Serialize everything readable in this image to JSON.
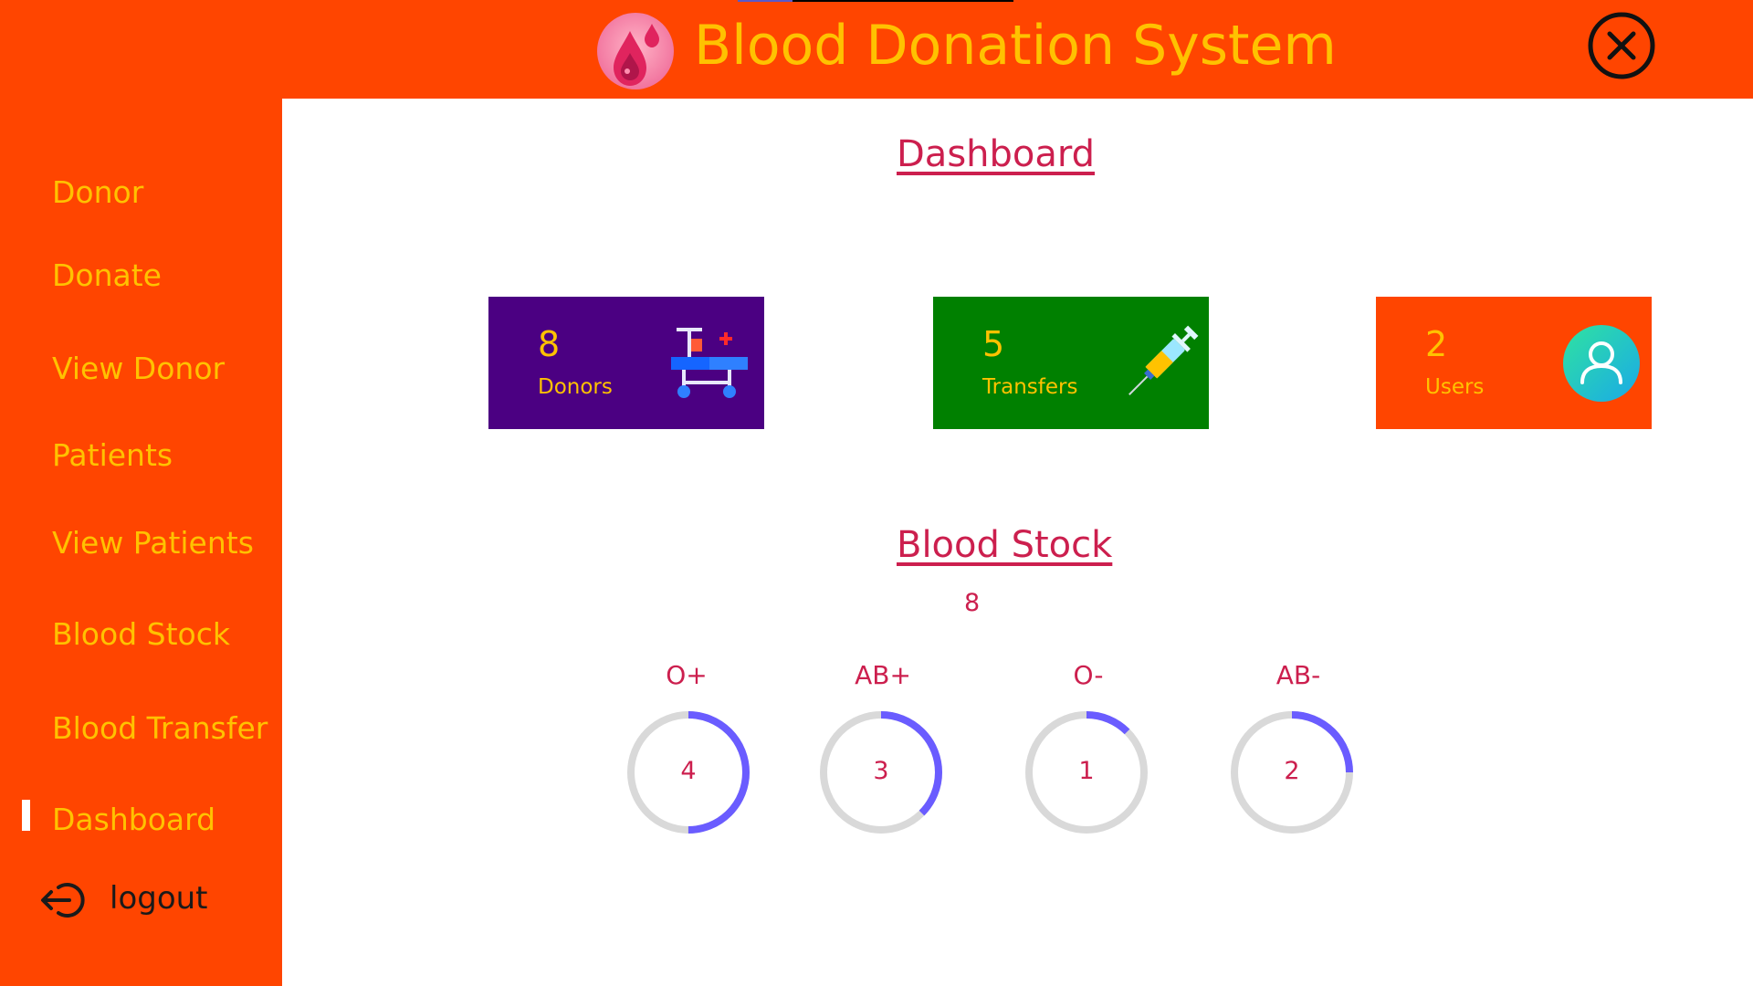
{
  "app": {
    "title": "Blood Donation System",
    "brand_color": "#ff4500",
    "accent_text_color": "#ffc200",
    "heading_color": "#cc1f4e",
    "logo_icon": "blood-drops-icon",
    "close_icon": "close-circle-icon"
  },
  "sidebar": {
    "items": [
      {
        "label": "Donor"
      },
      {
        "label": "Donate"
      },
      {
        "label": "View Donor"
      },
      {
        "label": "Patients"
      },
      {
        "label": "View Patients"
      },
      {
        "label": "Blood Stock"
      },
      {
        "label": "Blood Transfer"
      },
      {
        "label": "Dashboard",
        "active": true
      }
    ],
    "logout": {
      "label": "logout",
      "icon": "logout-icon"
    }
  },
  "dashboard": {
    "title": "Dashboard",
    "cards": [
      {
        "count": "8",
        "label": "Donors",
        "color": "#4b0082",
        "icon": "hospital-bed-icon"
      },
      {
        "count": "5",
        "label": "Transfers",
        "color": "#008000",
        "icon": "syringe-icon"
      },
      {
        "count": "2",
        "label": "Users",
        "color": "#ff4500",
        "icon": "user-avatar-icon"
      }
    ]
  },
  "blood_stock": {
    "title": "Blood Stock",
    "total": "8",
    "gauge_track_color": "#d9d9d9",
    "gauge_fill_color": "#6a5cff",
    "groups": [
      {
        "type": "O+",
        "value": "4",
        "fill_fraction": 0.5
      },
      {
        "type": "AB+",
        "value": "3",
        "fill_fraction": 0.375
      },
      {
        "type": "O-",
        "value": "1",
        "fill_fraction": 0.125
      },
      {
        "type": "AB-",
        "value": "2",
        "fill_fraction": 0.25
      }
    ]
  }
}
